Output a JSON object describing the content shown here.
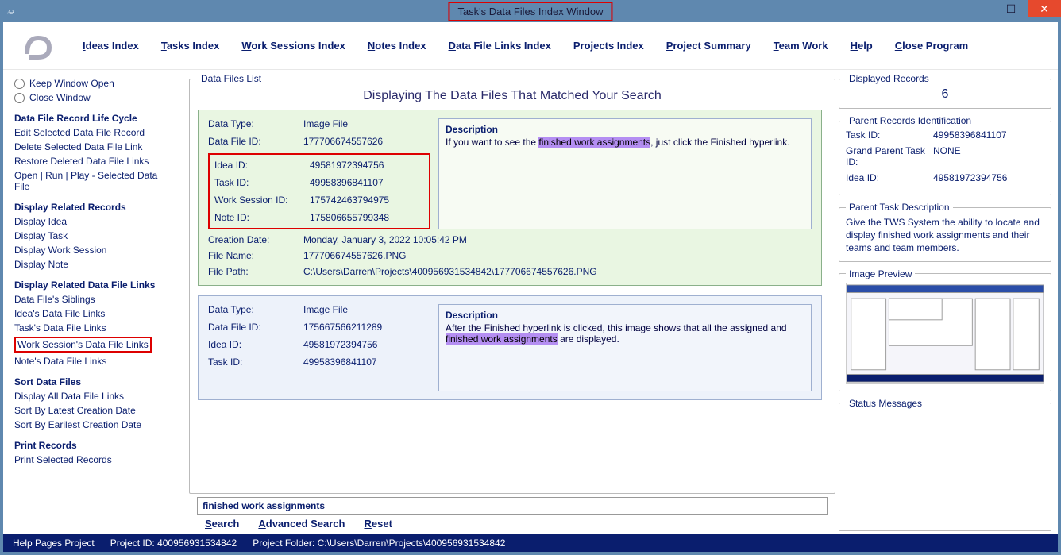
{
  "window": {
    "title": "Task's Data Files Index Window"
  },
  "menubar": {
    "ideas_index": "Ideas Index",
    "tasks_index": "Tasks Index",
    "work_sessions_index": "Work Sessions Index",
    "notes_index": "Notes Index",
    "data_file_links_index": "Data File Links Index",
    "projects_index": "Projects Index",
    "project_summary": "Project Summary",
    "team_work": "Team Work",
    "help": "Help",
    "close_program": "Close Program"
  },
  "sidebar": {
    "keep_window_open": "Keep Window Open",
    "close_window": "Close Window",
    "heads": {
      "life_cycle": "Data File Record Life Cycle",
      "related_records": "Display Related Records",
      "related_links": "Display Related Data File Links",
      "sort": "Sort Data Files",
      "print": "Print Records"
    },
    "life_cycle": {
      "edit": "Edit Selected Data File Record",
      "delete": "Delete Selected Data File Link",
      "restore": "Restore Deleted Data File Links",
      "open_run": "Open | Run | Play - Selected Data File"
    },
    "related_records": {
      "idea": "Display Idea",
      "task": "Display Task",
      "ws": "Display Work Session",
      "note": "Display Note"
    },
    "related_links": {
      "siblings": "Data File's Siblings",
      "idea": "Idea's Data File Links",
      "task": "Task's Data File Links",
      "ws": "Work Session's Data File Links",
      "note": "Note's Data File Links"
    },
    "sort": {
      "all": "Display All Data File Links",
      "latest": "Sort By Latest Creation Date",
      "earliest": "Sort By Earilest Creation Date"
    },
    "print": {
      "selected": "Print Selected Records"
    }
  },
  "main": {
    "list_legend": "Data Files List",
    "list_title": "Displaying The Data Files That Matched Your Search",
    "labels": {
      "data_type": "Data Type:",
      "data_file_id": "Data File ID:",
      "idea_id": "Idea ID:",
      "task_id": "Task ID:",
      "ws_id": "Work Session ID:",
      "note_id": "Note ID:",
      "creation_date": "Creation Date:",
      "file_name": "File Name:",
      "file_path": "File Path:",
      "description": "Description"
    },
    "records": [
      {
        "data_type": "Image File",
        "data_file_id": "177706674557626",
        "idea_id": "49581972394756",
        "task_id": "49958396841107",
        "ws_id": "175742463794975",
        "note_id": "175806655799348",
        "creation_date": "Monday, January 3, 2022  10:05:42 PM",
        "file_name": "177706674557626.PNG",
        "file_path": "C:\\Users\\Darren\\Projects\\400956931534842\\177706674557626.PNG",
        "desc_pre": "If you want to see the ",
        "desc_hl": "finished work assignments",
        "desc_post": ", just click the Finished hyperlink."
      },
      {
        "data_type": "Image File",
        "data_file_id": "175667566211289",
        "idea_id": "49581972394756",
        "task_id": "49958396841107",
        "desc_pre": "After the Finished hyperlink is clicked, this image shows that all the assigned and ",
        "desc_hl": "finished work assignments",
        "desc_post": " are displayed."
      }
    ],
    "search": {
      "value": "finished work assignments",
      "search_link": "Search",
      "advanced_link": "Advanced Search",
      "reset_link": "Reset"
    }
  },
  "right": {
    "displayed_records_legend": "Displayed Records",
    "displayed_records_value": "6",
    "parent_ident_legend": "Parent Records Identification",
    "parent_ident": {
      "task_id_lbl": "Task ID:",
      "task_id_val": "49958396841107",
      "gp_task_id_lbl": "Grand Parent Task ID:",
      "gp_task_id_val": "NONE",
      "idea_id_lbl": "Idea ID:",
      "idea_id_val": "49581972394756"
    },
    "parent_task_desc_legend": "Parent Task Description",
    "parent_task_desc": "Give the TWS System the ability to locate and display finished work assignments and their teams and team members.",
    "image_preview_legend": "Image Preview",
    "status_messages_legend": "Status Messages"
  },
  "statusbar": {
    "help_pages": "Help Pages Project",
    "project_id": "Project ID:  400956931534842",
    "project_folder": "Project Folder:  C:\\Users\\Darren\\Projects\\400956931534842"
  }
}
